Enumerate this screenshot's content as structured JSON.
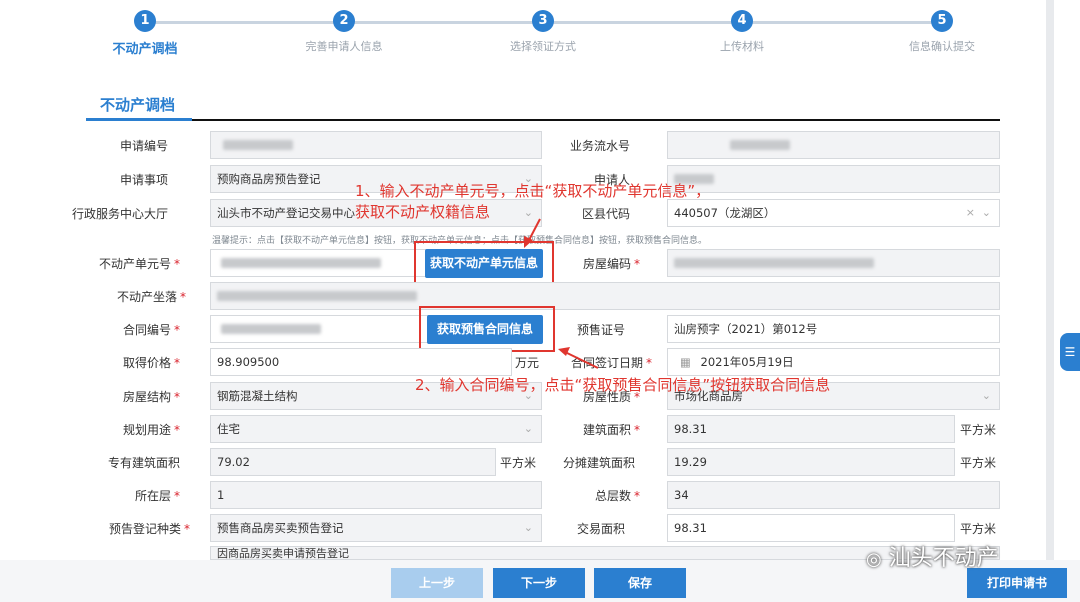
{
  "steps": [
    {
      "num": "1",
      "label": "不动产调档"
    },
    {
      "num": "2",
      "label": "完善申请人信息"
    },
    {
      "num": "3",
      "label": "选择领证方式"
    },
    {
      "num": "4",
      "label": "上传材料"
    },
    {
      "num": "5",
      "label": "信息确认提交"
    }
  ],
  "section_title": "不动产调档",
  "fields": {
    "apply_no_label": "申请编号",
    "serial_no_label": "业务流水号",
    "matter_label": "申请事项",
    "matter_value": "预购商品房预告登记",
    "applicant_label": "申请人",
    "hall_label": "行政服务中心大厅",
    "hall_value": "汕头市不动产登记交易中心",
    "district_label": "区县代码",
    "district_value": "440507（龙湖区）",
    "hint": "温馨提示：点击【获取不动产单元信息】按钮，获取不动产单元信息；点击【获取预售合同信息】按钮，获取预售合同信息。",
    "unit_no_label": "不动产单元号",
    "get_unit_btn": "获取不动产单元信息",
    "house_code_label": "房屋编码",
    "location_label": "不动产坐落",
    "contract_no_label": "合同编号",
    "get_contract_btn": "获取预售合同信息",
    "presale_no_label": "预售证号",
    "presale_no_value": "汕房预字（2021）第012号",
    "price_label": "取得价格",
    "price_value": "98.909500",
    "price_unit": "万元",
    "sign_date_label": "合同签订日期",
    "sign_date_value": "2021年05月19日",
    "structure_label": "房屋结构",
    "structure_value": "钢筋混凝土结构",
    "nature_label": "房屋性质",
    "nature_value": "市场化商品房",
    "usage_label": "规划用途",
    "usage_value": "住宅",
    "build_area_label": "建筑面积",
    "build_area_value": "98.31",
    "area_unit": "平方米",
    "own_area_label": "专有建筑面积",
    "own_area_value": "79.02",
    "share_area_label": "分摊建筑面积",
    "share_area_value": "19.29",
    "floor_label": "所在层",
    "floor_value": "1",
    "total_floor_label": "总层数",
    "total_floor_value": "34",
    "prereg_type_label": "预告登记种类",
    "prereg_type_value": "预售商品房买卖预告登记",
    "trade_area_label": "交易面积",
    "trade_area_value": "98.31",
    "reason_value": "因商品房买卖申请预告登记"
  },
  "annotations": {
    "note1_line1": "1、输入不动产单元号，点击“获取不动产单元信息”，",
    "note1_line2": "获取不动产权籍信息",
    "note2": "2、输入合同编号，点击“获取预售合同信息”按钮获取合同信息"
  },
  "buttons": {
    "prev": "上一步",
    "next": "下一步",
    "save": "保存",
    "print": "打印申请书"
  },
  "watermark": "汕头不动产",
  "colors": {
    "accent": "#2b7fd0",
    "annotation": "#e0362f",
    "required": "#d9232d"
  }
}
